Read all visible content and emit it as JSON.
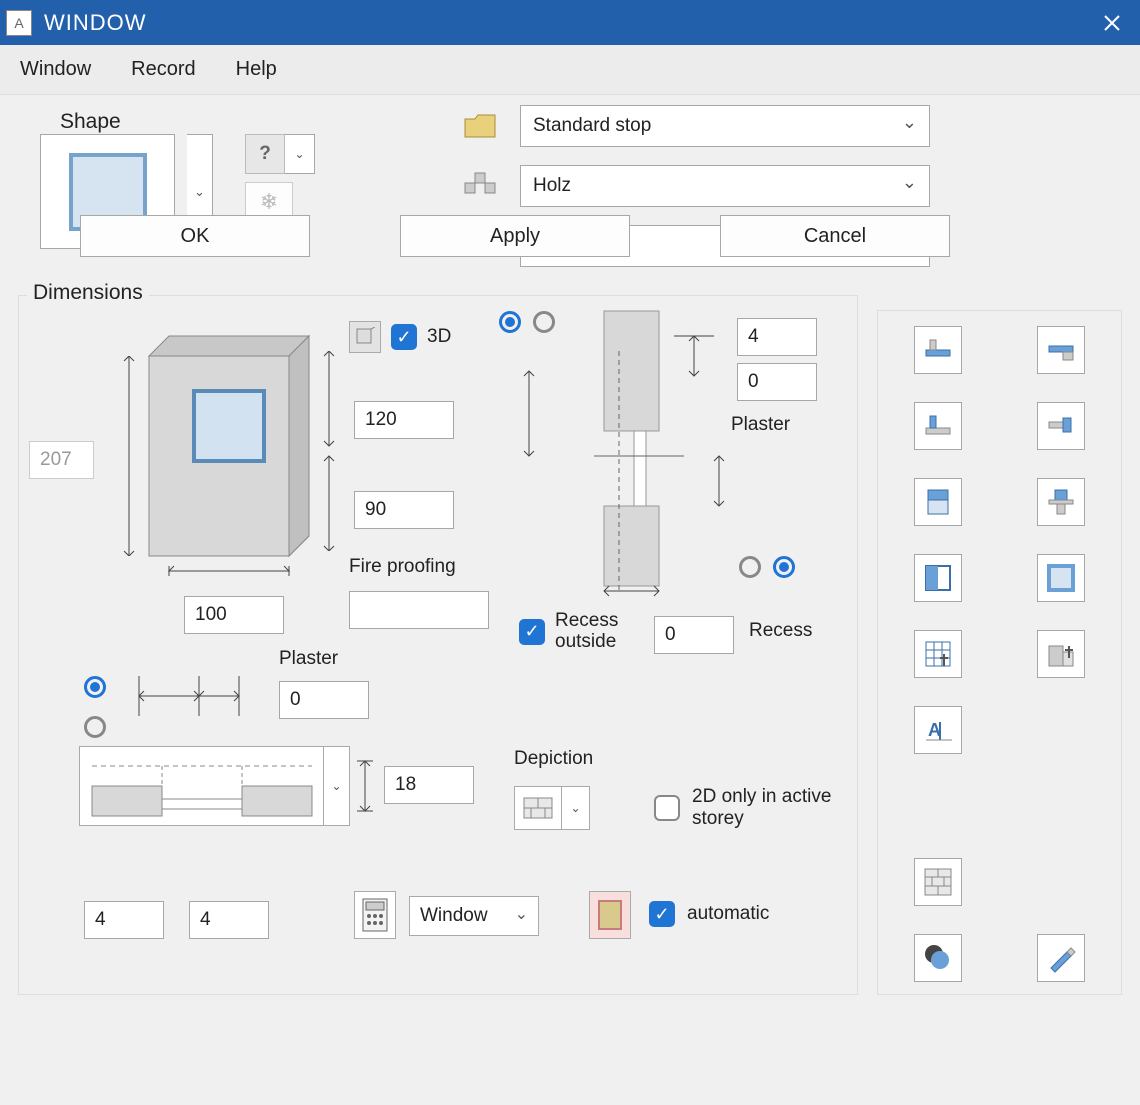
{
  "colors": {
    "primary_blue": "#2360ab",
    "accent_blue": "#2074d4"
  },
  "titlebar": {
    "title": "WINDOW"
  },
  "menu": {
    "window": "Window",
    "record": "Record",
    "help": "Help"
  },
  "shape": {
    "label": "Shape"
  },
  "dropdowns": {
    "stop": "Standard stop",
    "material": "Holz",
    "layer": "Window"
  },
  "dimensions": {
    "label": "Dimensions",
    "three_d_label": "3D",
    "value_207": "207",
    "height_120": "120",
    "height_90": "90",
    "width_100": "100",
    "fire_proofing_label": "Fire proofing",
    "fire_proofing_value": "",
    "plaster_label_left": "Plaster",
    "plaster_value_left": "0",
    "wall_thickness": "18",
    "top_right_4": "4",
    "top_right_0": "0",
    "plaster_label_right": "Plaster",
    "recess_outside_label": "Recess outside",
    "recess_outside_value": "0",
    "recess_label": "Recess",
    "depiction_label": "Depiction",
    "depiction_2d_label": "2D only in active storey",
    "bottom_left_a": "4",
    "bottom_left_b": "4",
    "window_select": "Window",
    "automatic_label": "automatic"
  },
  "buttons": {
    "ok": "OK",
    "apply": "Apply",
    "cancel": "Cancel"
  },
  "palette_names": [
    "sill-exterior",
    "sill-interior",
    "reveal-exterior",
    "reveal-interior",
    "blind",
    "shutter",
    "sash",
    "frame",
    "grid-settings",
    "wall-settings",
    "label-settings",
    null,
    null,
    null,
    "wall-material",
    "pen-edit"
  ]
}
